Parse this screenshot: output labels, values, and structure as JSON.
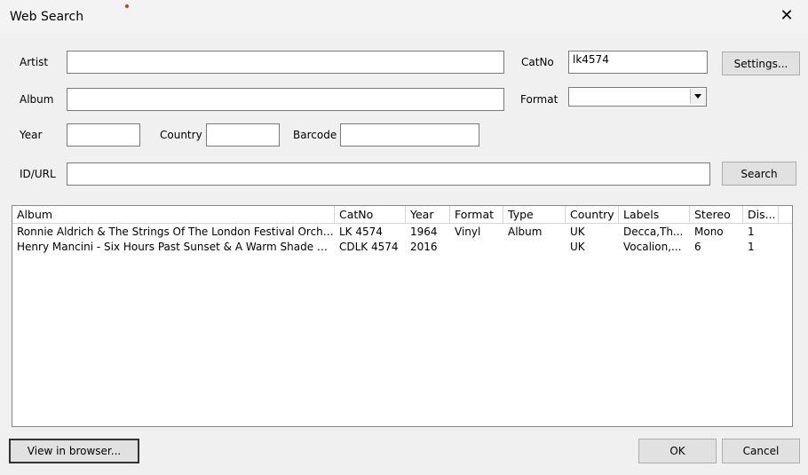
{
  "window": {
    "title": "Web Search"
  },
  "form": {
    "artist_label": "Artist",
    "artist_value": "",
    "catno_label": "CatNo",
    "catno_value": "lk4574",
    "settings_button": "Settings...",
    "album_label": "Album",
    "album_value": "",
    "format_label": "Format",
    "format_value": "",
    "year_label": "Year",
    "year_value": "",
    "country_label": "Country",
    "country_value": "",
    "barcode_label": "Barcode",
    "barcode_value": "",
    "idurl_label": "ID/URL",
    "idurl_value": "",
    "search_button": "Search"
  },
  "results": {
    "columns": [
      "Album",
      "CatNo",
      "Year",
      "Format",
      "Type",
      "Country",
      "Labels",
      "Stereo",
      "Dis..."
    ],
    "rows": [
      [
        "Ronnie Aldrich & The Strings Of The London Festival Orches...",
        "LK 4574",
        "1964",
        "Vinyl",
        "Album",
        "UK",
        "Decca,Th...",
        "Mono",
        "1"
      ],
      [
        "Henry Mancini - Six Hours Past Sunset & A Warm Shade Of ...",
        "CDLK 4574",
        "2016",
        "",
        "",
        "UK",
        "Vocalion,...",
        "6",
        "1"
      ]
    ]
  },
  "footer": {
    "view_browser_button": "View in browser...",
    "ok_button": "OK",
    "cancel_button": "Cancel"
  }
}
